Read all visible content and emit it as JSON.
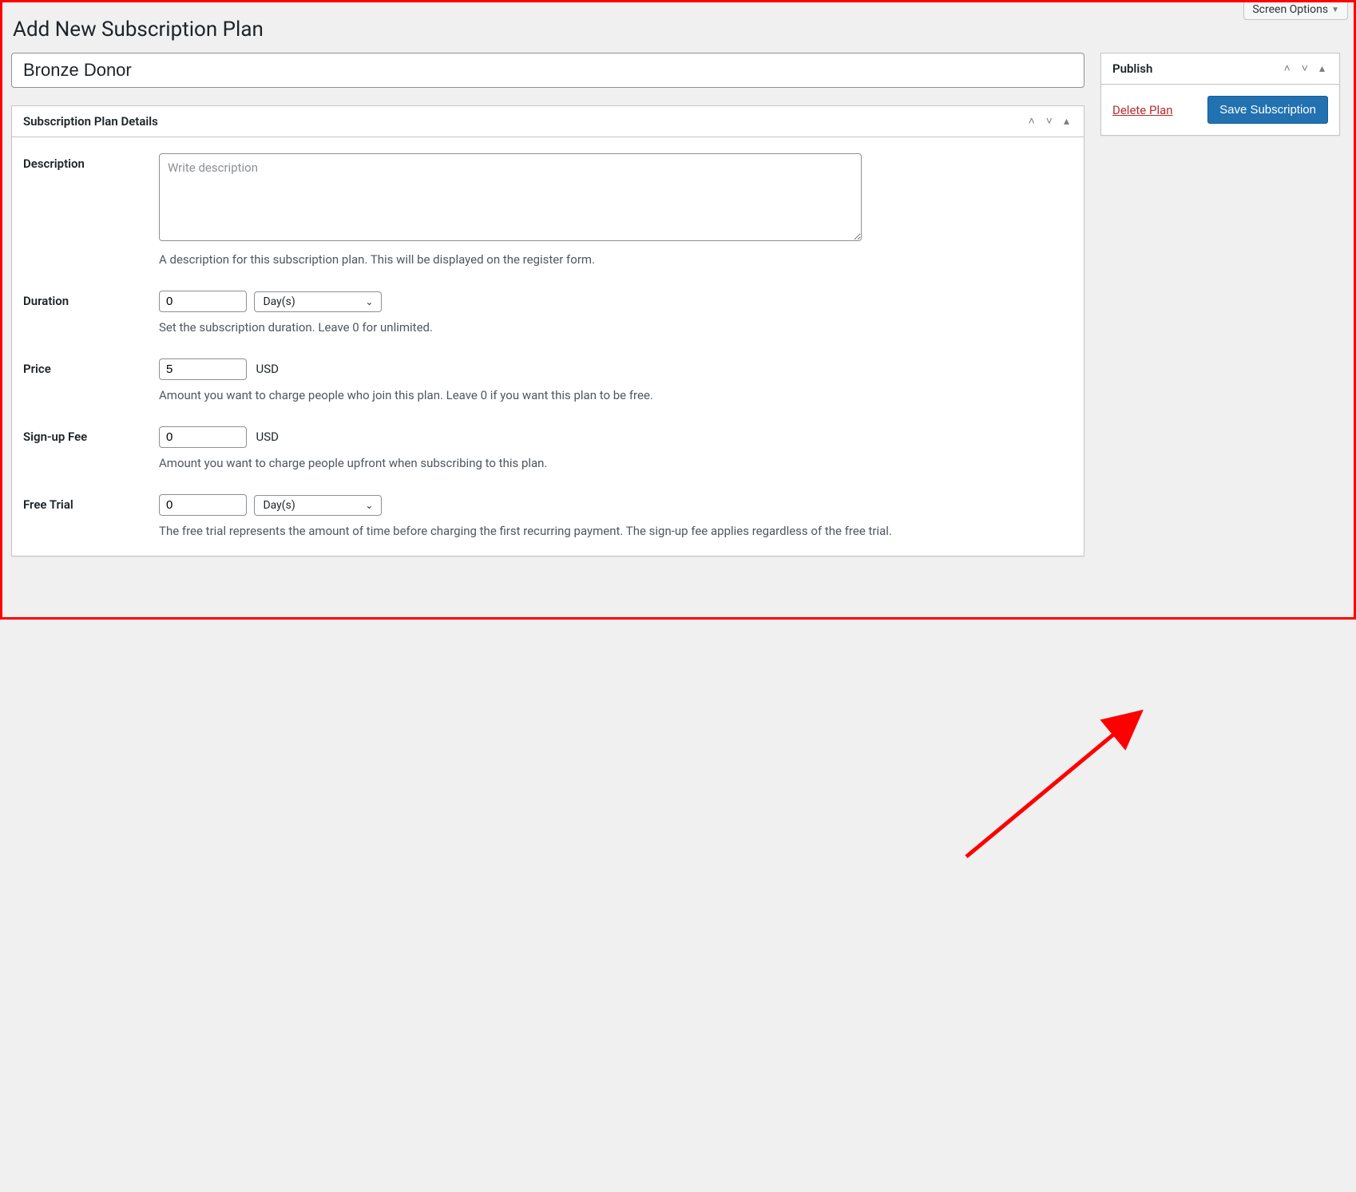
{
  "screenOptions": "Screen Options",
  "pageTitle": "Add New Subscription Plan",
  "titleValue": "Bronze Donor",
  "detailsPanel": {
    "heading": "Subscription Plan Details",
    "description": {
      "label": "Description",
      "placeholder": "Write description",
      "help": "A description for this subscription plan. This will be displayed on the register form."
    },
    "duration": {
      "label": "Duration",
      "value": "0",
      "unit": "Day(s)",
      "help": "Set the subscription duration. Leave 0 for unlimited."
    },
    "price": {
      "label": "Price",
      "value": "5",
      "currency": "USD",
      "help": "Amount you want to charge people who join this plan. Leave 0 if you want this plan to be free."
    },
    "signupFee": {
      "label": "Sign-up Fee",
      "value": "0",
      "currency": "USD",
      "help": "Amount you want to charge people upfront when subscribing to this plan."
    },
    "freeTrial": {
      "label": "Free Trial",
      "value": "0",
      "unit": "Day(s)",
      "help": "The free trial represents the amount of time before charging the first recurring payment. The sign-up fee applies regardless of the free trial."
    }
  },
  "publishPanel": {
    "heading": "Publish",
    "deleteLabel": "Delete Plan",
    "saveLabel": "Save Subscription"
  }
}
